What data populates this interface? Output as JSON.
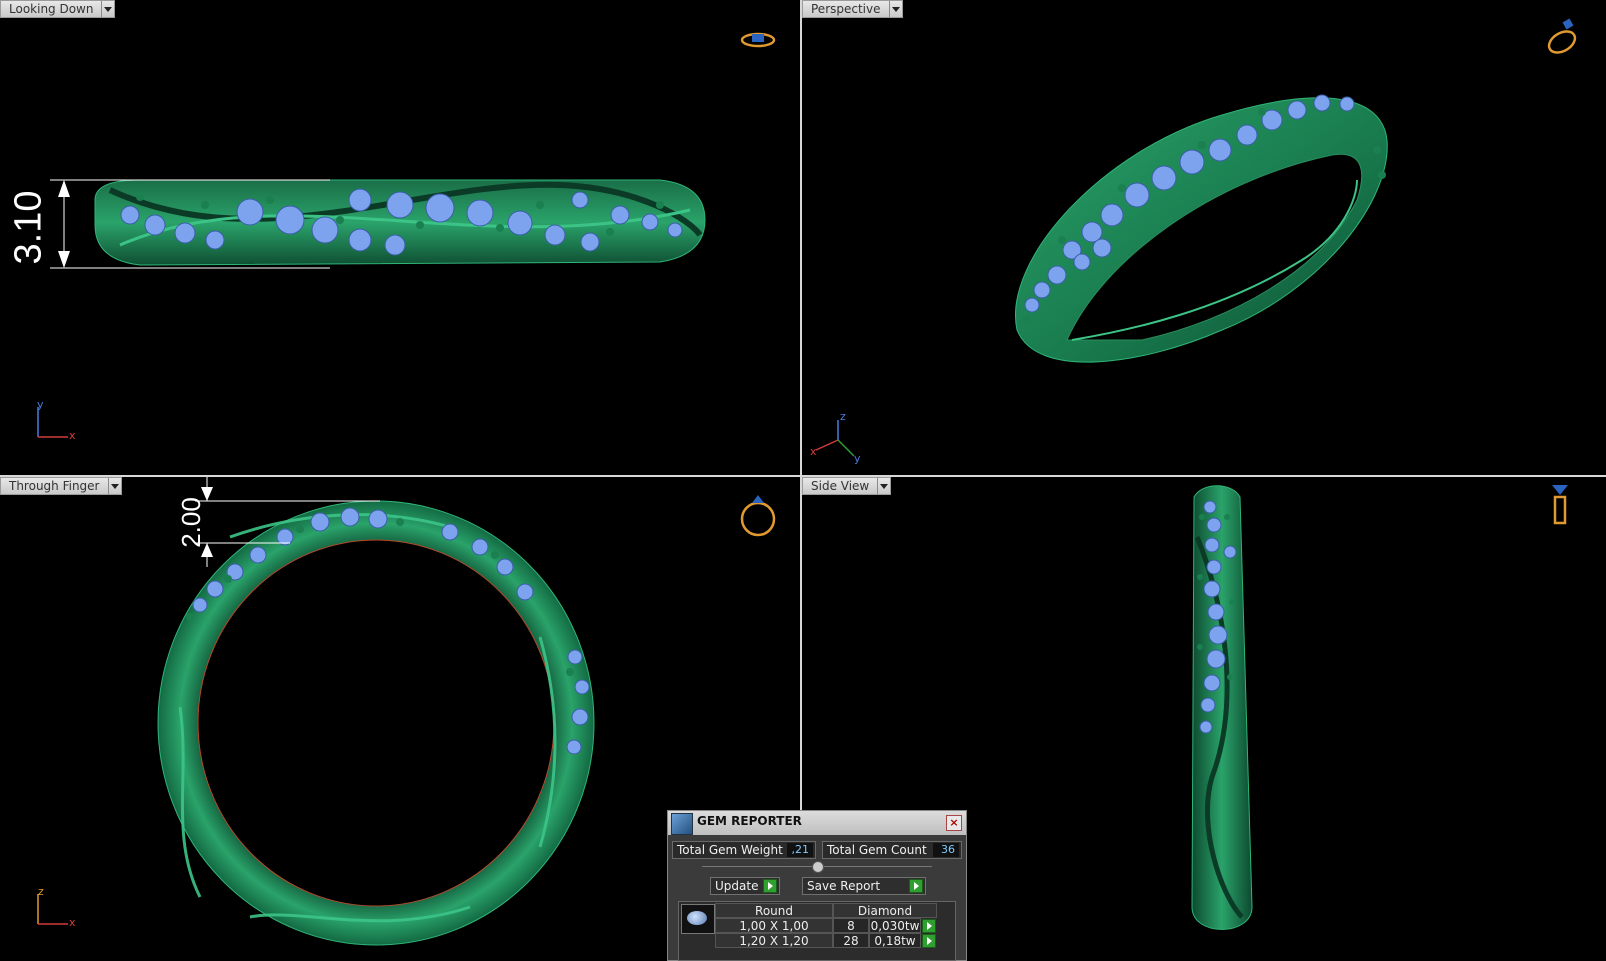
{
  "viewports": {
    "top_left": {
      "label": "Looking Down",
      "dimension": "3.10",
      "axes": [
        "y",
        "x"
      ]
    },
    "top_right": {
      "label": "Perspective",
      "axes": [
        "z",
        "x",
        "y"
      ]
    },
    "bottom_left": {
      "label": "Through Finger",
      "dimension": "2.00",
      "axes": [
        "z",
        "x"
      ]
    },
    "bottom_right": {
      "label": "Side View"
    }
  },
  "gem_reporter": {
    "title": "GEM REPORTER",
    "close": "×",
    "total_weight_label": "Total Gem Weight",
    "total_weight_value": ",21",
    "total_count_label": "Total Gem Count",
    "total_count_value": "36",
    "update_label": "Update",
    "save_label": "Save Report",
    "table": {
      "headers": [
        "Round",
        "Diamond"
      ],
      "rows": [
        {
          "size": "1,00 X 1,00",
          "count": "8",
          "weight": "0,030tw"
        },
        {
          "size": "1,20 X 1,20",
          "count": "28",
          "weight": "0,18tw"
        }
      ]
    }
  },
  "colors": {
    "metal": "#1f8c5a",
    "gem": "#6f95e6",
    "background": "#000000"
  }
}
